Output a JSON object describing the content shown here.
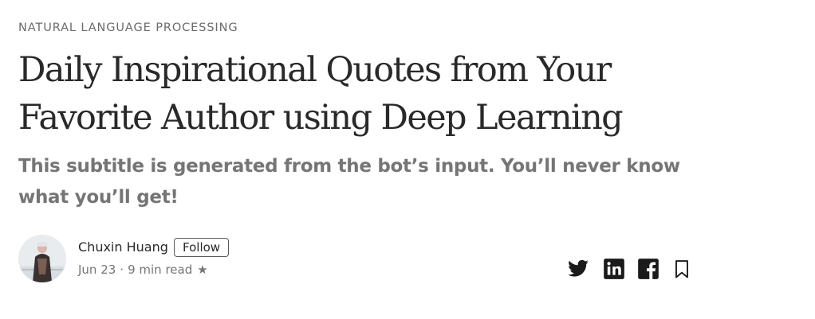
{
  "article": {
    "kicker": "NATURAL LANGUAGE PROCESSING",
    "title": "Daily Inspirational Quotes from Your Favorite Author using Deep Learning",
    "subtitle": "This subtitle is generated from the bot’s input. You’ll never know what you’ll get!"
  },
  "author": {
    "name": "Chuxin Huang",
    "follow_label": "Follow",
    "avatar_icon": "avatar-photo"
  },
  "meta": {
    "date": "Jun 23",
    "separator": "·",
    "read_time": "9 min read",
    "star": "★"
  },
  "actions": {
    "icons": [
      "twitter-icon",
      "linkedin-icon",
      "facebook-icon",
      "bookmark-icon"
    ]
  },
  "colors": {
    "text_primary": "#292929",
    "text_secondary": "#757575",
    "icon": "#1a1a1a"
  }
}
